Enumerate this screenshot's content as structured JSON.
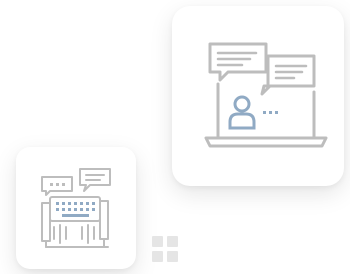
{
  "cards": [
    {
      "illustration": "laptop-chat-person-icon"
    },
    {
      "illustration": "team-keyboard-chat-icon"
    }
  ],
  "decoration": {
    "icon": "dot-grid-icon"
  },
  "colors": {
    "line_gray": "#bdbdbd",
    "accent_blue": "#90aac4",
    "card_bg": "#ffffff",
    "grid_gray": "#e5e5e5"
  }
}
